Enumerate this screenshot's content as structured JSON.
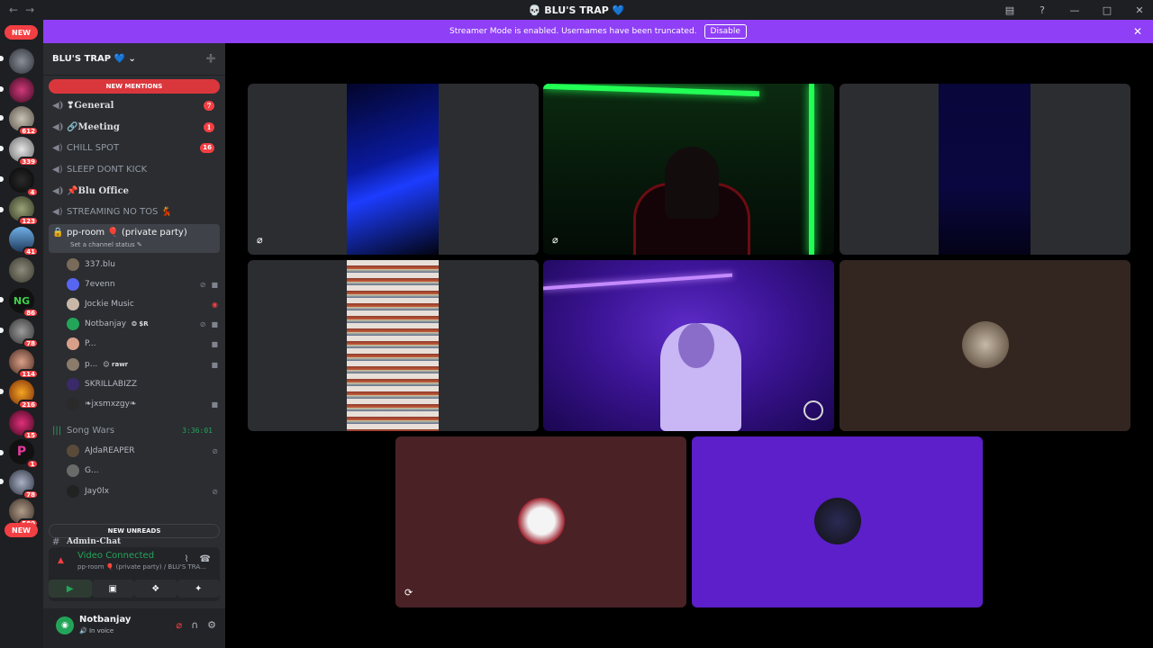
{
  "titlebar": {
    "title": "💀 BLU'S TRAP 💙",
    "back_icon": "←",
    "forward_icon": "→",
    "inbox_icon": "▤",
    "help_icon": "?",
    "minimize_icon": "—",
    "maximize_icon": "□",
    "close_icon": "✕"
  },
  "rail": {
    "new_top": "NEW",
    "new_bottom": "NEW",
    "badges": [
      "612",
      "339",
      "4",
      "123",
      "41",
      "86",
      "78",
      "114",
      "216",
      "15",
      "1",
      "78",
      "580"
    ]
  },
  "banner": {
    "text": "Streamer Mode is enabled. Usernames have been truncated.",
    "button": "Disable",
    "close": "✕"
  },
  "sidebar": {
    "server_name": "BLU'S TRAP 💙",
    "chevron": "⌄",
    "add_member_icon": "➕",
    "new_mentions": "NEW MENTIONS",
    "new_unreads": "NEW UNREADS",
    "channels": [
      {
        "name": "❣𝐆𝐞𝐧𝐞𝐫𝐚𝐥",
        "count": "7"
      },
      {
        "name": "🔗𝐌𝐞𝐞𝐭𝐢𝐧𝐠",
        "count": "1"
      },
      {
        "name": "CHILL SPOT",
        "count": "16"
      },
      {
        "name": "SLEEP DONT KICK",
        "count": ""
      },
      {
        "name": "📌𝐁𝐥𝐮 𝐎𝐟𝐟𝐢𝐜𝐞",
        "count": ""
      },
      {
        "name": "STREAMING NO TOS 💃",
        "count": ""
      }
    ],
    "active_channel": {
      "name": "pp-room 🎈 (private party)",
      "status": "Set a channel status ✎"
    },
    "members": [
      {
        "name": "337.blu",
        "tag": ""
      },
      {
        "name": "7evenn",
        "tag": ""
      },
      {
        "name": "Jockie Music",
        "tag": ""
      },
      {
        "name": "Notbanjay",
        "tag": "❂ $R"
      },
      {
        "name": "P...",
        "tag": ""
      },
      {
        "name": "p...",
        "tag": "☺ rawr"
      },
      {
        "name": "SKRILLABIZZ",
        "tag": ""
      },
      {
        "name": "❧jxsmxzgy❧",
        "tag": ""
      }
    ],
    "song_wars": {
      "name": "Song Wars",
      "time": "3:36:01"
    },
    "song_members": [
      "AJdaREAPER",
      "G...",
      "Jay0lx"
    ],
    "hidden_channel": "Admin-Chat"
  },
  "voice": {
    "title": "Video Connected",
    "subtitle": "pp-room 🎈 (private party) / BLU'S TRA...",
    "noise_icon": "⌇",
    "disconnect_icon": "☎",
    "signal_icon": "▲",
    "buttons": [
      "▶",
      "▣",
      "❖",
      "✦"
    ]
  },
  "user": {
    "name": "Notbanjay",
    "status": "🔊 In voice",
    "mute_icon": "⌀",
    "headset_icon": "∩",
    "settings_icon": "⚙"
  },
  "tiles": {
    "muted_icon": "⌀",
    "activity_icon": "⟳"
  },
  "colors": {
    "accent_purple": "#8f3ff6",
    "voice_green": "#23a559",
    "alert_red": "#f23f43"
  }
}
